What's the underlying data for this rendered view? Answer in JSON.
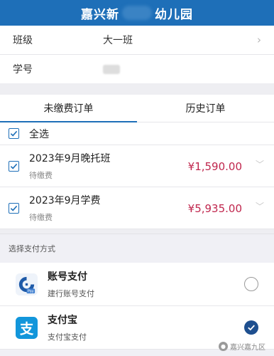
{
  "header": {
    "title_left": "嘉兴新",
    "title_right": "幼儿园"
  },
  "info": {
    "class_label": "班级",
    "class_value": "大一班",
    "student_no_label": "学号"
  },
  "tabs": [
    {
      "label": "未缴费订单",
      "active": true
    },
    {
      "label": "历史订单",
      "active": false
    }
  ],
  "select_all_label": "全选",
  "orders": [
    {
      "name": "2023年9月晚托班",
      "status": "待缴费",
      "amount": "¥1,590.00",
      "checked": true
    },
    {
      "name": "2023年9月学费",
      "status": "待缴费",
      "amount": "¥5,935.00",
      "checked": true
    }
  ],
  "payment": {
    "section_label": "选择支付方式",
    "methods": [
      {
        "name": "账号支付",
        "desc": "建行账号支付",
        "icon": "ccb-bank-icon",
        "selected": false
      },
      {
        "name": "支付宝",
        "desc": "支付宝支付",
        "icon": "alipay-icon",
        "selected": true
      }
    ]
  },
  "watermark": "嘉兴嘉九区",
  "colors": {
    "brand": "#1e6fb8",
    "amount": "#c0264d",
    "alipay": "#1296db",
    "radio_selected": "#1e4f8f"
  }
}
